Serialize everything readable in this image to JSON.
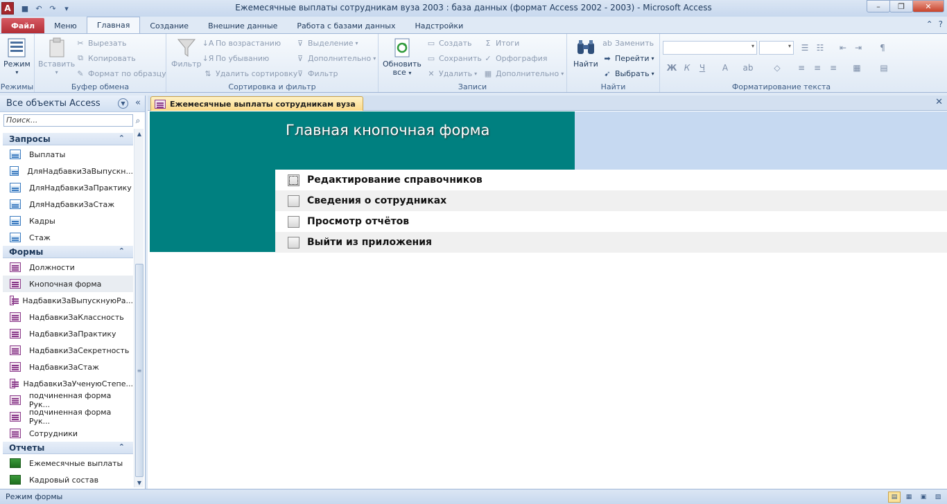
{
  "window": {
    "title": "Ежемесячные выплаты сотрудникам вуза 2003 : база данных (формат Access 2002 - 2003)  -  Microsoft Access",
    "app_icon_letter": "A"
  },
  "tabs": {
    "file": "Файл",
    "items": [
      "Меню",
      "Главная",
      "Создание",
      "Внешние данные",
      "Работа с базами данных",
      "Надстройки"
    ],
    "active": "Главная"
  },
  "ribbon": {
    "views": {
      "mode_label": "Режим",
      "group": "Режимы"
    },
    "clipboard": {
      "paste": "Вставить",
      "cut": "Вырезать",
      "copy": "Копировать",
      "format_painter": "Формат по образцу",
      "group": "Буфер обмена"
    },
    "sort": {
      "filter": "Фильтр",
      "asc": "По возрастанию",
      "desc": "По убыванию",
      "remove": "Удалить сортировку",
      "selection": "Выделение",
      "advanced": "Дополнительно",
      "toggle": "Фильтр",
      "group": "Сортировка и фильтр"
    },
    "records": {
      "refresh": "Обновить",
      "refresh2": "все",
      "create": "Создать",
      "save": "Сохранить",
      "delete": "Удалить",
      "totals": "Итоги",
      "spelling": "Орфография",
      "more": "Дополнительно",
      "group": "Записи"
    },
    "find": {
      "find": "Найти",
      "replace": "Заменить",
      "goto": "Перейти",
      "select": "Выбрать",
      "group": "Найти"
    },
    "text_format": {
      "group": "Форматирование текста",
      "bold": "Ж",
      "italic": "К",
      "underline": "Ч"
    }
  },
  "nav": {
    "header": "Все объекты Access",
    "search_placeholder": "Поиск...",
    "sections": [
      {
        "title": "Запросы",
        "type": "query",
        "items": [
          "Выплаты",
          "ДляНадбавкиЗаВыпускн...",
          "ДляНадбавкиЗаПрактику",
          "ДляНадбавкиЗаСтаж",
          "Кадры",
          "Стаж"
        ]
      },
      {
        "title": "Формы",
        "type": "form",
        "items": [
          "Должности",
          "Кнопочная форма",
          "НадбавкиЗаВыпускнуюРа...",
          "НадбавкиЗаКлассность",
          "НадбавкиЗаПрактику",
          "НадбавкиЗаСекретность",
          "НадбавкиЗаСтаж",
          "НадбавкиЗаУченуюСтепе...",
          "подчиненная форма Рук...",
          "подчиненная форма Рук...",
          "Сотрудники"
        ]
      },
      {
        "title": "Отчеты",
        "type": "report",
        "items": [
          "Ежемесячные выплаты",
          "Кадровый состав"
        ]
      }
    ],
    "selected": "Кнопочная форма"
  },
  "document": {
    "tab_title": "Ежемесячные выплаты сотрудникам вуза",
    "form_title": "Главная кнопочная форма",
    "menu_items": [
      "Редактирование справочников",
      "Сведения о сотрудниках",
      "Просмотр отчётов",
      "Выйти из приложения"
    ]
  },
  "status": {
    "text": "Режим формы"
  }
}
